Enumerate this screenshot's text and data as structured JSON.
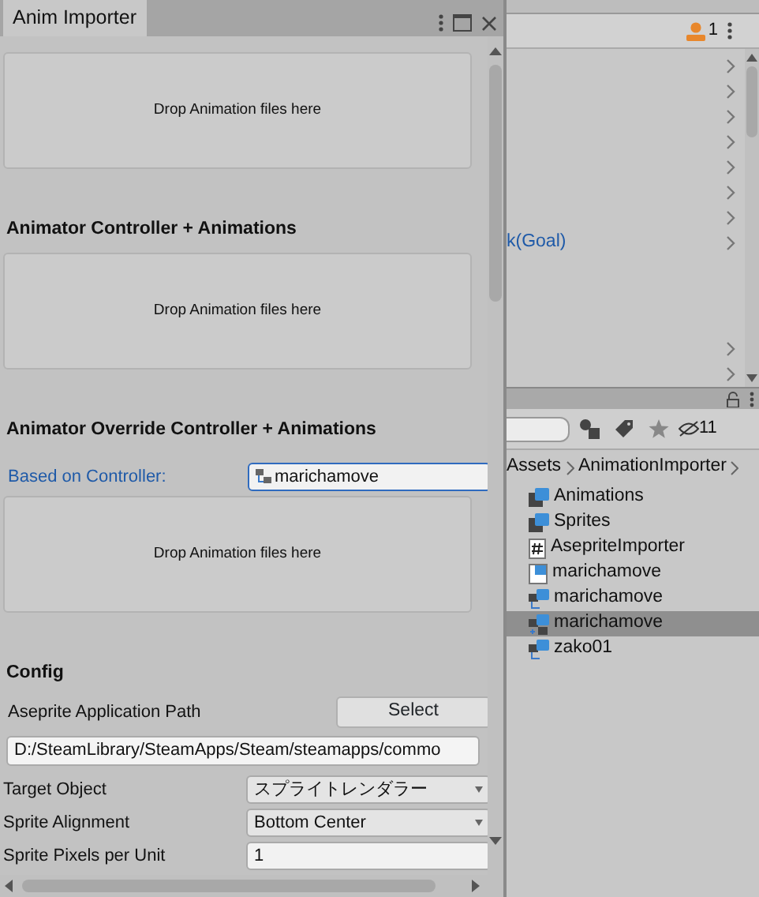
{
  "window": {
    "title": "Anim Importer"
  },
  "blocks": [
    {
      "kind": "drop",
      "text": "Drop Animation files here"
    },
    {
      "kind": "heading",
      "text": "Animator Controller + Animations"
    },
    {
      "kind": "drop",
      "text": "Drop Animation files here"
    },
    {
      "kind": "heading",
      "text": "Animator Override Controller + Animations"
    },
    {
      "kind": "object",
      "label": "Based on Controller:",
      "value": "marichamove"
    },
    {
      "kind": "drop",
      "text": "Drop Animation files here"
    },
    {
      "kind": "heading",
      "text": "Config"
    },
    {
      "kind": "path",
      "label": "Aseprite Application Path",
      "button": "Select",
      "value": "D:/SteamLibrary/SteamApps/Steam/steamapps/commo"
    },
    {
      "kind": "dropdown",
      "label": "Target Object",
      "value": "スプライトレンダラー"
    },
    {
      "kind": "dropdown",
      "label": "Sprite Alignment",
      "value": "Bottom Center"
    },
    {
      "kind": "input",
      "label": "Sprite Pixels per Unit",
      "value": "1"
    }
  ],
  "hierarchy": {
    "count": "1",
    "rows": [
      {
        "kind": "row"
      },
      {
        "kind": "row"
      },
      {
        "kind": "row"
      },
      {
        "kind": "row"
      },
      {
        "kind": "row"
      },
      {
        "kind": "row"
      },
      {
        "kind": "row"
      },
      {
        "kind": "row",
        "label": "k(Goal)"
      },
      {
        "kind": "spacer"
      },
      {
        "kind": "row"
      },
      {
        "kind": "row"
      }
    ]
  },
  "project": {
    "hidden_count": "11",
    "breadcrumb": [
      "Assets",
      "AnimationImporter"
    ],
    "assets": [
      {
        "kind": "folder",
        "label": "Animations",
        "selected": false
      },
      {
        "kind": "folder",
        "label": "Sprites",
        "selected": false
      },
      {
        "kind": "script",
        "label": "AsepriteImporter",
        "selected": false
      },
      {
        "kind": "anim",
        "label": "marichamove",
        "selected": false
      },
      {
        "kind": "controller",
        "label": "marichamove",
        "selected": false
      },
      {
        "kind": "override",
        "label": "marichamove",
        "selected": true
      },
      {
        "kind": "controller",
        "label": "zako01",
        "selected": false
      }
    ]
  }
}
